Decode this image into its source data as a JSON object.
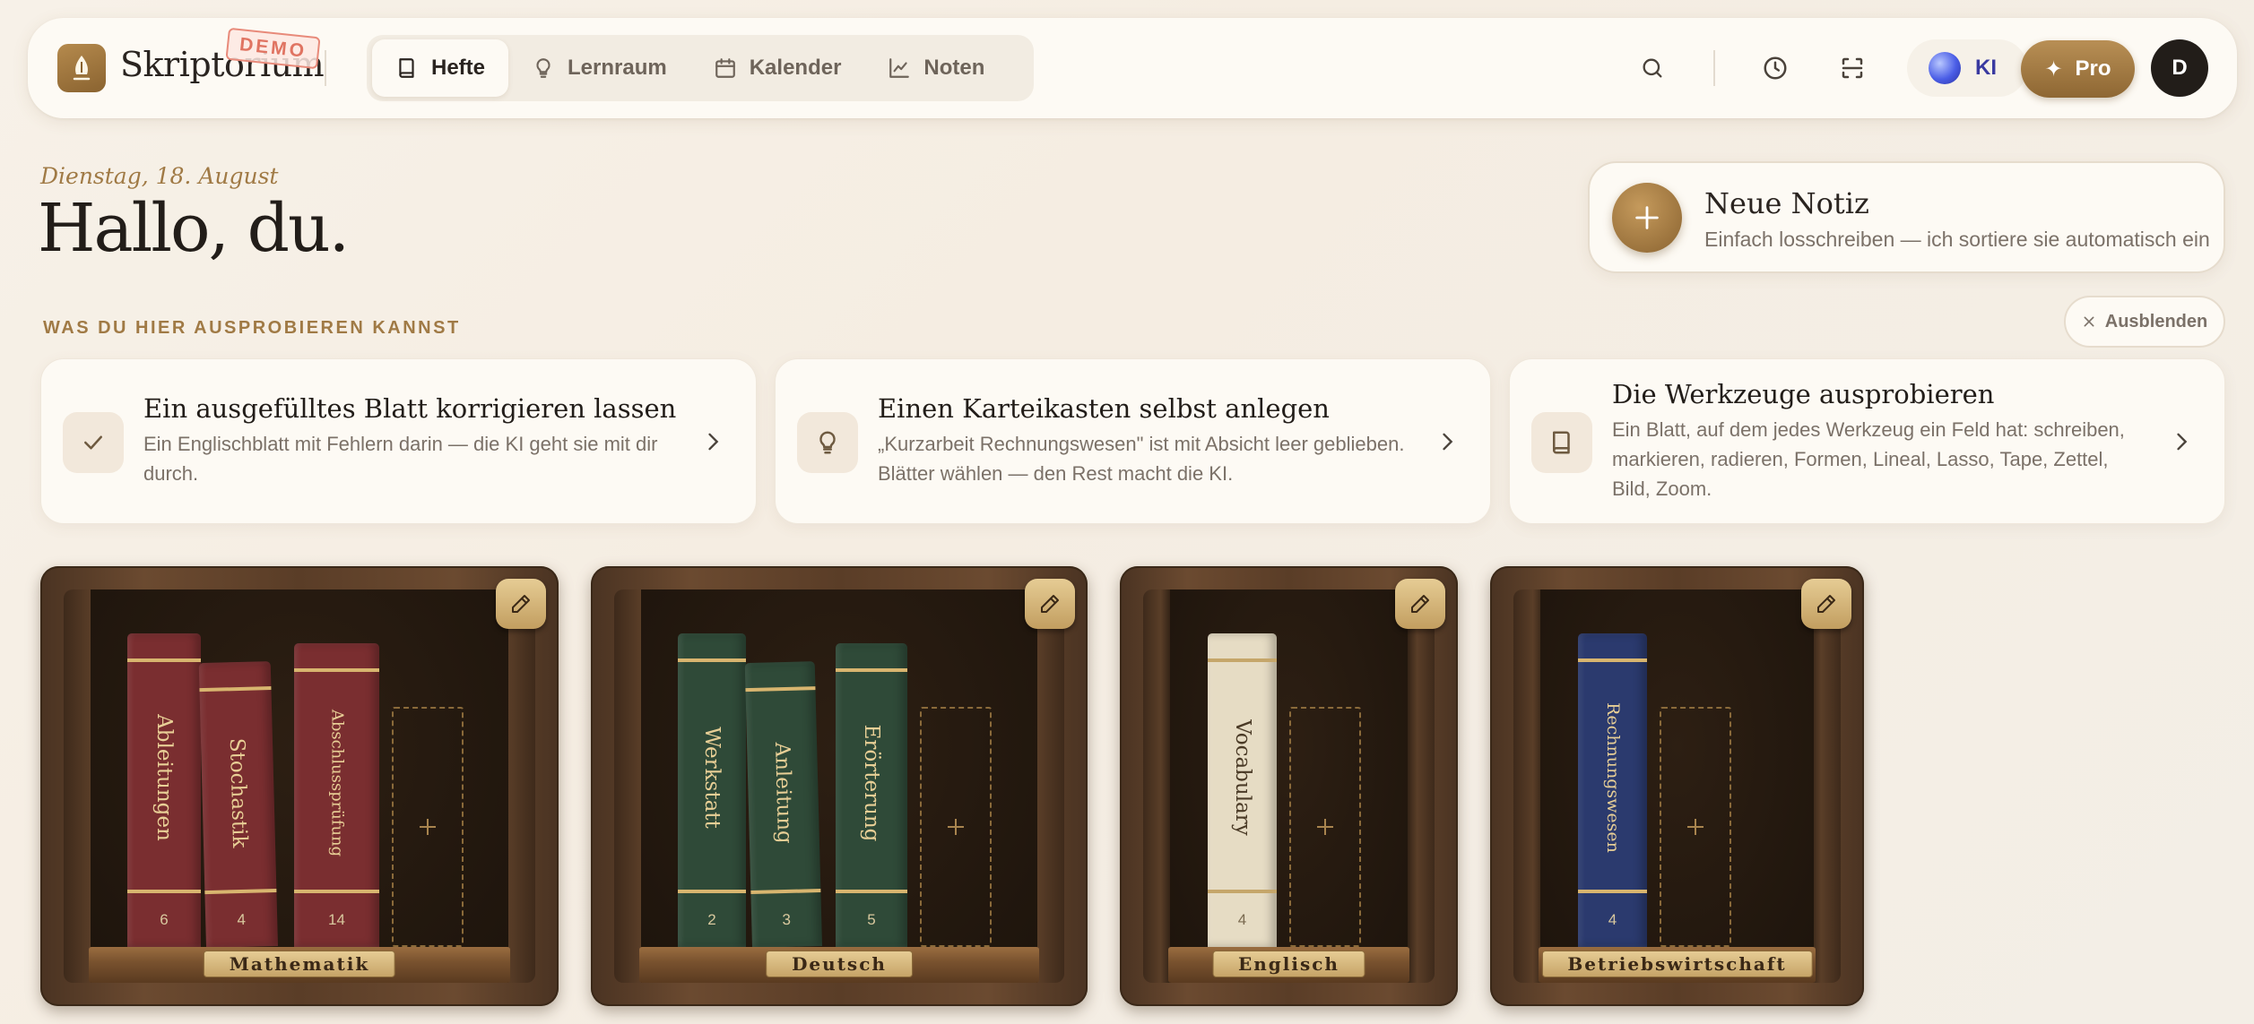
{
  "header": {
    "brand": "Skriptorium",
    "demo_badge": "DEMO",
    "nav": [
      {
        "label": "Hefte",
        "icon": "book-icon",
        "active": true
      },
      {
        "label": "Lernraum",
        "icon": "lightbulb-icon",
        "active": false
      },
      {
        "label": "Kalender",
        "icon": "calendar-icon",
        "active": false
      },
      {
        "label": "Noten",
        "icon": "chart-icon",
        "active": false
      }
    ],
    "ki_label": "KI",
    "pro_label": "Pro",
    "pro_icon": "✦",
    "avatar_initial": "D"
  },
  "greeting": {
    "date": "Dienstag, 18. August",
    "hello": "Hallo, du."
  },
  "new_note": {
    "title": "Neue Notiz",
    "subtitle": "Einfach losschreiben — ich sortiere sie automatisch ein"
  },
  "try_section": {
    "label": "WAS DU HIER AUSPROBIEREN KANNST",
    "hide_label": "Ausblenden",
    "cards": [
      {
        "title": "Ein ausgefülltes Blatt korrigieren lassen",
        "desc": "Ein Englischblatt mit Fehlern darin — die KI geht sie mit dir durch.",
        "icon": "check-icon"
      },
      {
        "title": "Einen Karteikasten selbst anlegen",
        "desc": "„Kurzarbeit Rechnungswesen\" ist mit Absicht leer geblieben. Blätter wählen — den Rest macht die KI.",
        "icon": "lightbulb-icon"
      },
      {
        "title": "Die Werkzeuge ausprobieren",
        "desc": "Ein Blatt, auf dem jedes Werkzeug ein Feld hat: schreiben, markieren, radieren, Formen, Lineal, Lasso, Tape, Zettel, Bild, Zoom.",
        "icon": "book-icon"
      }
    ]
  },
  "shelves": [
    {
      "label": "Mathematik",
      "books": [
        {
          "title": "Ableitungen",
          "count": "6",
          "color": "#7a2e30"
        },
        {
          "title": "Stochastik",
          "count": "4",
          "color": "#7a2e30"
        },
        {
          "title": "Abschlussprüfung",
          "count": "14",
          "color": "#7a2e30"
        }
      ]
    },
    {
      "label": "Deutsch",
      "books": [
        {
          "title": "Werkstatt",
          "count": "2",
          "color": "#2f4a38"
        },
        {
          "title": "Anleitung",
          "count": "3",
          "color": "#2f4a38"
        },
        {
          "title": "Erörterung",
          "count": "5",
          "color": "#2f4a38"
        }
      ]
    },
    {
      "label": "Englisch",
      "books": [
        {
          "title": "Vocabulary",
          "count": "4",
          "color": "#e6dcc4"
        }
      ]
    },
    {
      "label": "Betriebswirtschaft",
      "books": [
        {
          "title": "Rechnungswesen",
          "count": "4",
          "color": "#2b3a6e"
        }
      ]
    }
  ]
}
